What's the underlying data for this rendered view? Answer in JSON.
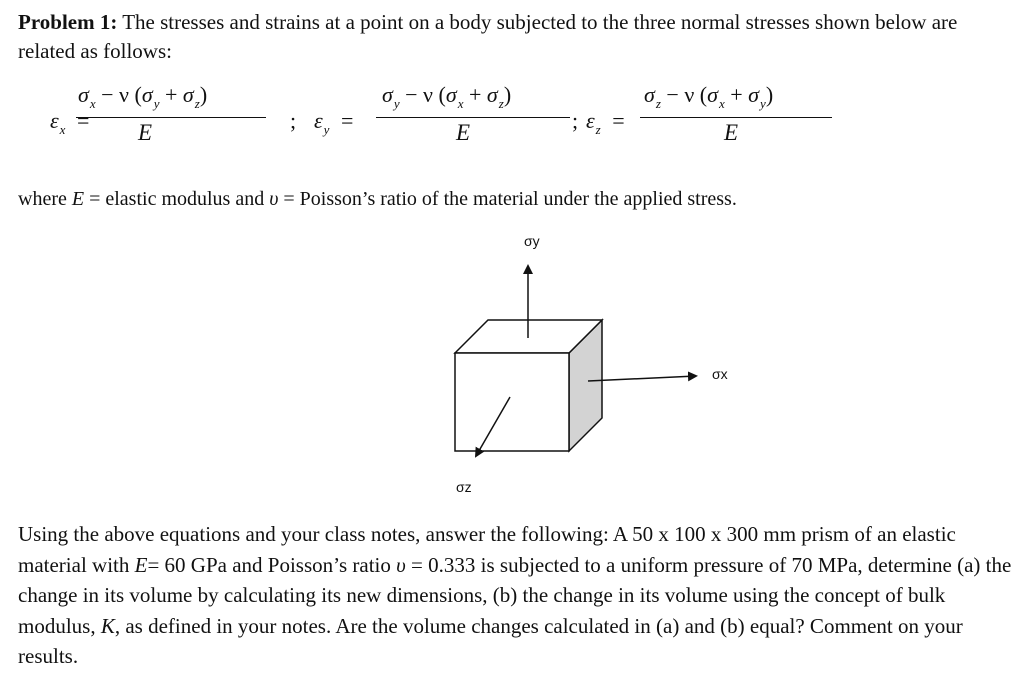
{
  "intro": {
    "label": "Problem 1:",
    "text": " The stresses and strains at a point on a body subjected to the three normal stresses shown below are related as follows:"
  },
  "equations": [
    {
      "lhs_symbol": "ε",
      "lhs_sub": "x",
      "equals": "=",
      "numerator": {
        "s1": "σ",
        "s1_sub": "x",
        "minus": " − ν (",
        "s2": "σ",
        "s2_sub": "y",
        "plus": " + ",
        "s3": "σ",
        "s3_sub": "z",
        "close": ")"
      },
      "denominator": "E",
      "separator": ";"
    },
    {
      "lhs_symbol": "ε",
      "lhs_sub": "y",
      "equals": "=",
      "numerator": {
        "s1": "σ",
        "s1_sub": "y",
        "minus": " − ν (",
        "s2": "σ",
        "s2_sub": "x",
        "plus": " + ",
        "s3": "σ",
        "s3_sub": "z",
        "close": ")"
      },
      "denominator": "E",
      "separator": ";"
    },
    {
      "lhs_symbol": "ε",
      "lhs_sub": "z",
      "equals": "=",
      "numerator": {
        "s1": "σ",
        "s1_sub": "z",
        "minus": " − ν (",
        "s2": "σ",
        "s2_sub": "x",
        "plus": " + ",
        "s3": "σ",
        "s3_sub": "y",
        "close": ")"
      },
      "denominator": "E"
    }
  ],
  "where": {
    "prefix": "where ",
    "e_symbol": "E",
    "e_text": " = elastic modulus and ",
    "v_symbol": "υ",
    "v_text": " = Poisson’s ratio of the material under the applied stress."
  },
  "diagram": {
    "label_y": "σy",
    "label_x": "σx",
    "label_z": "σz",
    "side_face_color": "#d3d3d3"
  },
  "question": {
    "p1": "Using the above equations and your class notes, answer the following: A 50 x 100 x 300 mm prism of an elastic material with ",
    "e_symbol": "E",
    "p2": "= 60 GPa and Poisson’s ratio ",
    "v_symbol": "υ",
    "p3": " = 0.333 is subjected to a uniform pressure of 70 MPa, determine (a) the change in its volume by calculating its new dimensions, (b) the change in its volume using the concept of bulk modulus, ",
    "k_symbol": "K",
    "p4": ", as defined in your notes. Are the volume changes calculated in (a) and (b) equal? Comment on your results."
  }
}
